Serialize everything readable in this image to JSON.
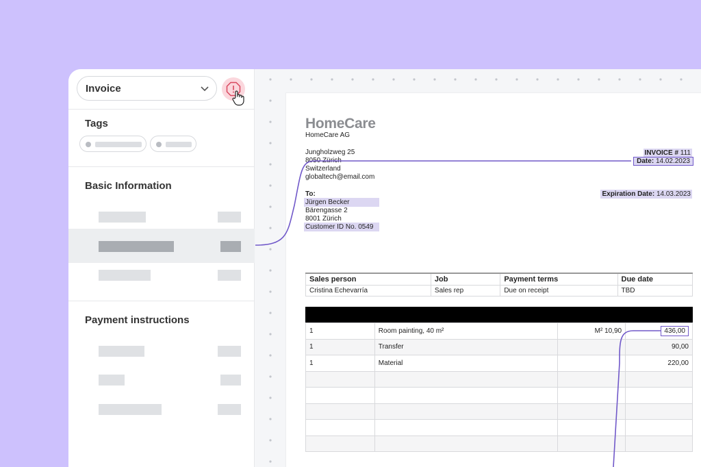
{
  "sidebar": {
    "document_type": "Invoice",
    "tags_title": "Tags",
    "basic_info_title": "Basic Information",
    "payment_title": "Payment instructions"
  },
  "invoice": {
    "logo": "HomeCare",
    "company": "HomeCare AG",
    "sender_street": "Jungholzweg 25",
    "sender_city": "8050 Zürich",
    "sender_country": "Switzerland",
    "sender_email": "globaltech@email.com",
    "invoice_label": "INVOICE #",
    "invoice_number": "111",
    "date_label": "Date:",
    "date_value": "14.02.2023",
    "expiration_label": "Expiration Date:",
    "expiration_value": "14.03.2023",
    "to_label": "To:",
    "recipient_name": "Jürgen Becker",
    "recipient_street": "Bärengasse 2",
    "recipient_city": "8001 Zürich",
    "customer_id": "Customer ID No. 0549",
    "info_headers": [
      "Sales person",
      "Job",
      "Payment terms",
      "Due date"
    ],
    "info_values": [
      "Cristina Echevarría",
      "Sales rep",
      "Due on receipt",
      "TBD"
    ],
    "items": [
      {
        "qty": "1",
        "desc": "Room painting, 40 m²",
        "unit": "M² 10,90",
        "amount": "436,00"
      },
      {
        "qty": "1",
        "desc": "Transfer",
        "unit": "",
        "amount": "90,00"
      },
      {
        "qty": "1",
        "desc": "Material",
        "unit": "",
        "amount": "220,00"
      }
    ]
  },
  "colors": {
    "background": "#cdc1fd",
    "accent": "#7058c9",
    "highlight": "#dcd7f2",
    "alert": "#fbd7dd"
  }
}
